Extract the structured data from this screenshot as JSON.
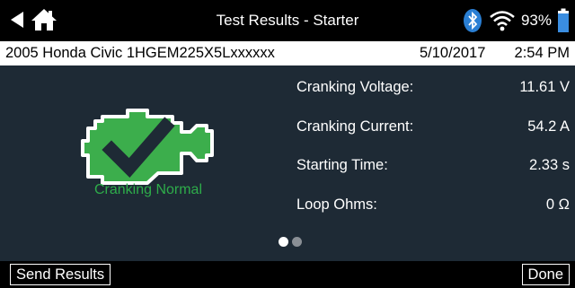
{
  "header": {
    "title": "Test Results - Starter",
    "battery_percent": "93%",
    "icons": [
      "back-arrow-icon",
      "home-icon",
      "bluetooth-icon",
      "wifi-icon",
      "battery-icon"
    ]
  },
  "info_bar": {
    "vehicle": "2005 Honda Civic 1HGEM225X5Lxxxxxx",
    "date": "5/10/2017",
    "time": "2:54 PM"
  },
  "result": {
    "icon": "engine-check-icon",
    "status": "Cranking Normal"
  },
  "metrics": [
    {
      "label": "Cranking Voltage:",
      "value": "11.61 V"
    },
    {
      "label": "Cranking Current:",
      "value": "54.2 A"
    },
    {
      "label": "Starting Time:",
      "value": "2.33 s"
    },
    {
      "label": "Loop Ohms:",
      "value": "0 Ω"
    }
  ],
  "pager": {
    "current_page": 1,
    "total_pages": 2
  },
  "footer": {
    "send_label": "Send Results",
    "done_label": "Done"
  },
  "colors": {
    "background": "#1e2a35",
    "status_green": "#2eac4a",
    "bluetooth_blue": "#2a7fd4",
    "battery_blue": "#3a8de0"
  }
}
